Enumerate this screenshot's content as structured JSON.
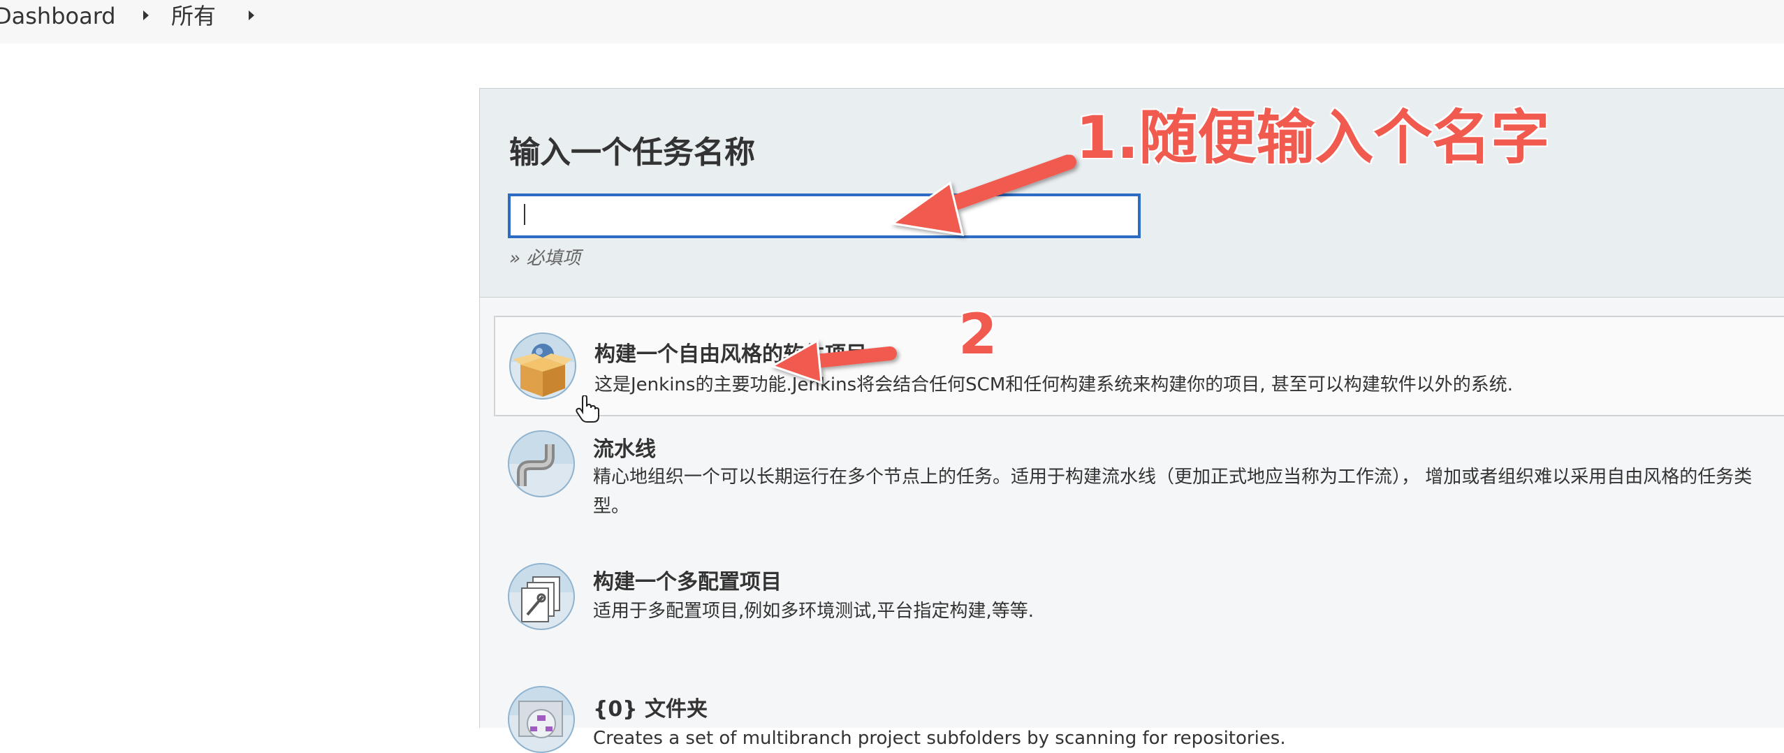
{
  "breadcrumb": {
    "items": [
      "Dashboard",
      "所有"
    ]
  },
  "new_item": {
    "title": "输入一个任务名称",
    "input_value": "",
    "required_hint": "» 必填项"
  },
  "item_types": [
    {
      "title": "构建一个自由风格的软件项目",
      "description": "这是Jenkins的主要功能.Jenkins将会结合任何SCM和任何构建系统来构建你的项目, 甚至可以构建软件以外的系统.",
      "icon": "freestyle-box-icon"
    },
    {
      "title": "流水线",
      "description": "精心地组织一个可以长期运行在多个节点上的任务。适用于构建流水线（更加正式地应当称为工作流）， 增加或者组织难以采用自由风格的任务类型。",
      "icon": "pipeline-icon"
    },
    {
      "title": "构建一个多配置项目",
      "description": "适用于多配置项目,例如多环境测试,平台指定构建,等等.",
      "icon": "multi-config-icon"
    },
    {
      "title": "{0} 文件夹",
      "description": "Creates a set of multibranch project subfolders by scanning for repositories.",
      "icon": "folder-icon"
    }
  ],
  "annotations": {
    "step1": "1.随便输入个名字",
    "step2": "2",
    "color": "#f15a4f"
  }
}
